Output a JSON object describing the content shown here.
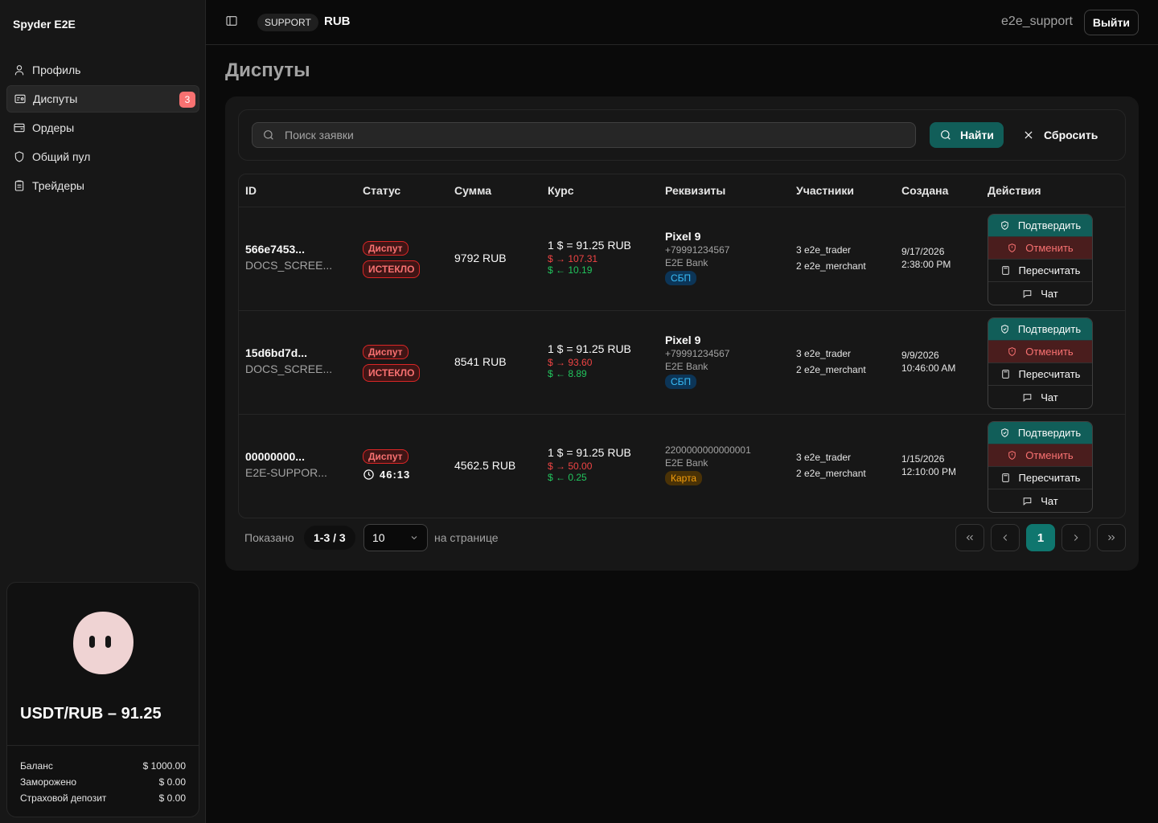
{
  "app": {
    "name": "Spyder E2E"
  },
  "sidebar": {
    "items": [
      {
        "label": "Профиль",
        "icon": "user-icon"
      },
      {
        "label": "Диспуты",
        "icon": "ticket-icon",
        "badge": "3",
        "active": true
      },
      {
        "label": "Ордеры",
        "icon": "wallet-icon"
      },
      {
        "label": "Общий пул",
        "icon": "shield-icon"
      },
      {
        "label": "Трейдеры",
        "icon": "clipboard-icon"
      }
    ],
    "rate_card": {
      "title": "USDT/RUB – 91.25",
      "rows": [
        {
          "label": "Баланс",
          "value": "$ 1000.00"
        },
        {
          "label": "Заморожено",
          "value": "$ 0.00"
        },
        {
          "label": "Страховой депозит",
          "value": "$ 0.00"
        }
      ]
    }
  },
  "header": {
    "role": "SUPPORT",
    "currency": "RUB",
    "username": "e2e_support",
    "logout_label": "Выйти"
  },
  "page": {
    "title": "Диспуты"
  },
  "search": {
    "placeholder": "Поиск заявки",
    "value": "",
    "find_label": "Найти",
    "reset_label": "Сбросить"
  },
  "table": {
    "columns": [
      "ID",
      "Статус",
      "Сумма",
      "Курс",
      "Реквизиты",
      "Участники",
      "Создана",
      "Действия"
    ],
    "rows": [
      {
        "id": "566e7453...",
        "ref": "DOCS_SCREE...",
        "status": "Диспут",
        "status2": "ИСТЕКЛО",
        "amount": "9792 RUB",
        "rate": "1 $ = 91.25 RUB",
        "rate_up": "$ → 107.31",
        "rate_down": "$ ← 10.19",
        "req_name": "Pixel 9",
        "req_phone": "+79991234567",
        "req_bank": "E2E Bank",
        "req_tag": "СБП",
        "participant1": "3 e2e_trader",
        "participant2": "2 e2e_merchant",
        "created_date": "9/17/2026",
        "created_time": "2:38:00 PM"
      },
      {
        "id": "15d6bd7d...",
        "ref": "DOCS_SCREE...",
        "status": "Диспут",
        "status2": "ИСТЕКЛО",
        "amount": "8541 RUB",
        "rate": "1 $ = 91.25 RUB",
        "rate_up": "$ → 93.60",
        "rate_down": "$ ← 8.89",
        "req_name": "Pixel 9",
        "req_phone": "+79991234567",
        "req_bank": "E2E Bank",
        "req_tag": "СБП",
        "participant1": "3 e2e_trader",
        "participant2": "2 e2e_merchant",
        "created_date": "9/9/2026",
        "created_time": "10:46:00 AM"
      },
      {
        "id": "00000000...",
        "ref": "E2E-SUPPOR...",
        "status": "Диспут",
        "timer": "46:13",
        "amount": "4562.5 RUB",
        "rate": "1 $ = 91.25 RUB",
        "rate_up": "$ → 50.00",
        "rate_down": "$ ← 0.25",
        "req_card": "2200000000000001",
        "req_bank": "E2E Bank",
        "req_tag": "Карта",
        "participant1": "3 e2e_trader",
        "participant2": "2 e2e_merchant",
        "created_date": "1/15/2026",
        "created_time": "12:10:00 PM"
      }
    ],
    "actions": {
      "confirm": "Подтвердить",
      "cancel": "Отменить",
      "recalc": "Пересчитать",
      "chat": "Чат"
    }
  },
  "footer": {
    "shown_label": "Показано",
    "shown_value": "1-3 / 3",
    "per_page_value": "10",
    "per_page_label": "на странице",
    "current_page": "1"
  },
  "colors": {
    "accent": "#115e59",
    "danger": "#ef4444",
    "success": "#22c55e"
  }
}
